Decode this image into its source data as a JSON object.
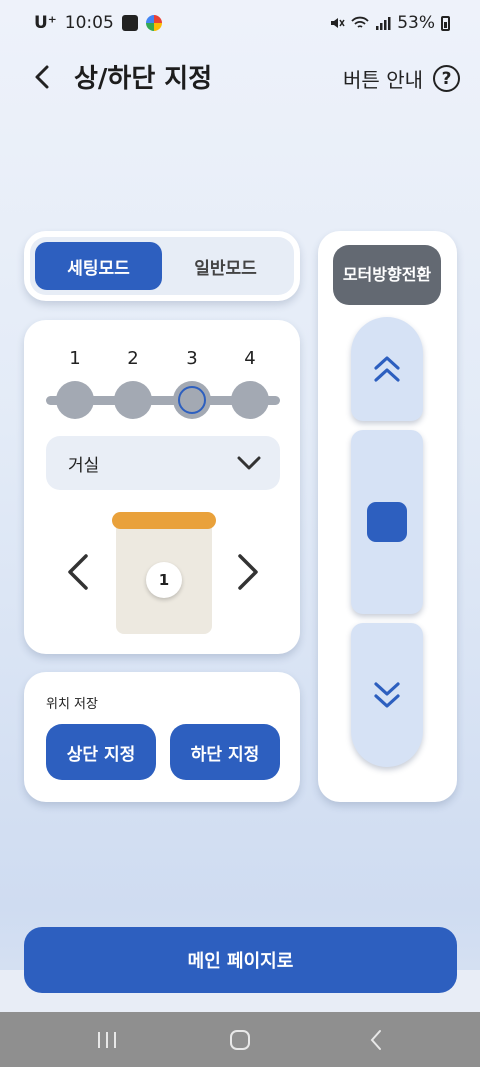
{
  "status": {
    "carrier": "U⁺",
    "time": "10:05",
    "battery": "53%"
  },
  "header": {
    "title": "상/하단 지정",
    "help_label": "버튼 안내",
    "help_icon": "question-circle-icon"
  },
  "mode": {
    "tabs": [
      "세팅모드",
      "일반모드"
    ],
    "active_index": 0
  },
  "positions": {
    "numbers": [
      "1",
      "2",
      "3",
      "4"
    ],
    "selected_index": 2
  },
  "room": {
    "selected": "거실"
  },
  "blind": {
    "number": "1"
  },
  "save": {
    "label": "위치 저장",
    "top_button": "상단 지정",
    "bottom_button": "하단 지정"
  },
  "motor": {
    "direction_button": "모터방향전환",
    "up_icon": "double-chevron-up-icon",
    "stop_icon": "stop-square-icon",
    "down_icon": "double-chevron-down-icon"
  },
  "footer": {
    "main_button": "메인 페이지로"
  },
  "colors": {
    "primary": "#2d5fbf",
    "accent": "#e9a13b",
    "gray_button": "#636972"
  }
}
